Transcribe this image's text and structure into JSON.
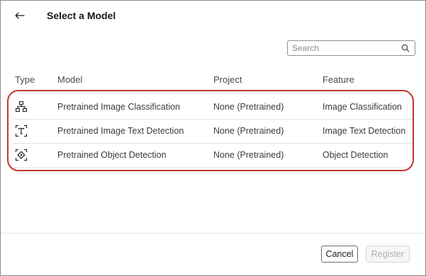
{
  "header": {
    "back_icon": "arrow-left-icon",
    "title": "Select a Model"
  },
  "search": {
    "placeholder": "Search",
    "value": "",
    "icon": "search-icon"
  },
  "table": {
    "columns": [
      "Type",
      "Model",
      "Project",
      "Feature"
    ],
    "rows": [
      {
        "type_icon": "hierarchy-icon",
        "model": "Pretrained Image Classification",
        "project": "None (Pretrained)",
        "feature": "Image Classification"
      },
      {
        "type_icon": "text-detection-icon",
        "model": "Pretrained Image Text Detection",
        "project": "None (Pretrained)",
        "feature": "Image Text Detection"
      },
      {
        "type_icon": "object-detection-icon",
        "model": "Pretrained Object Detection",
        "project": "None (Pretrained)",
        "feature": "Object Detection"
      }
    ]
  },
  "footer": {
    "cancel_label": "Cancel",
    "register_label": "Register"
  },
  "colors": {
    "highlight": "#c0392b",
    "text": "#3c3c3c",
    "disabled_text": "#b0b0b0"
  }
}
